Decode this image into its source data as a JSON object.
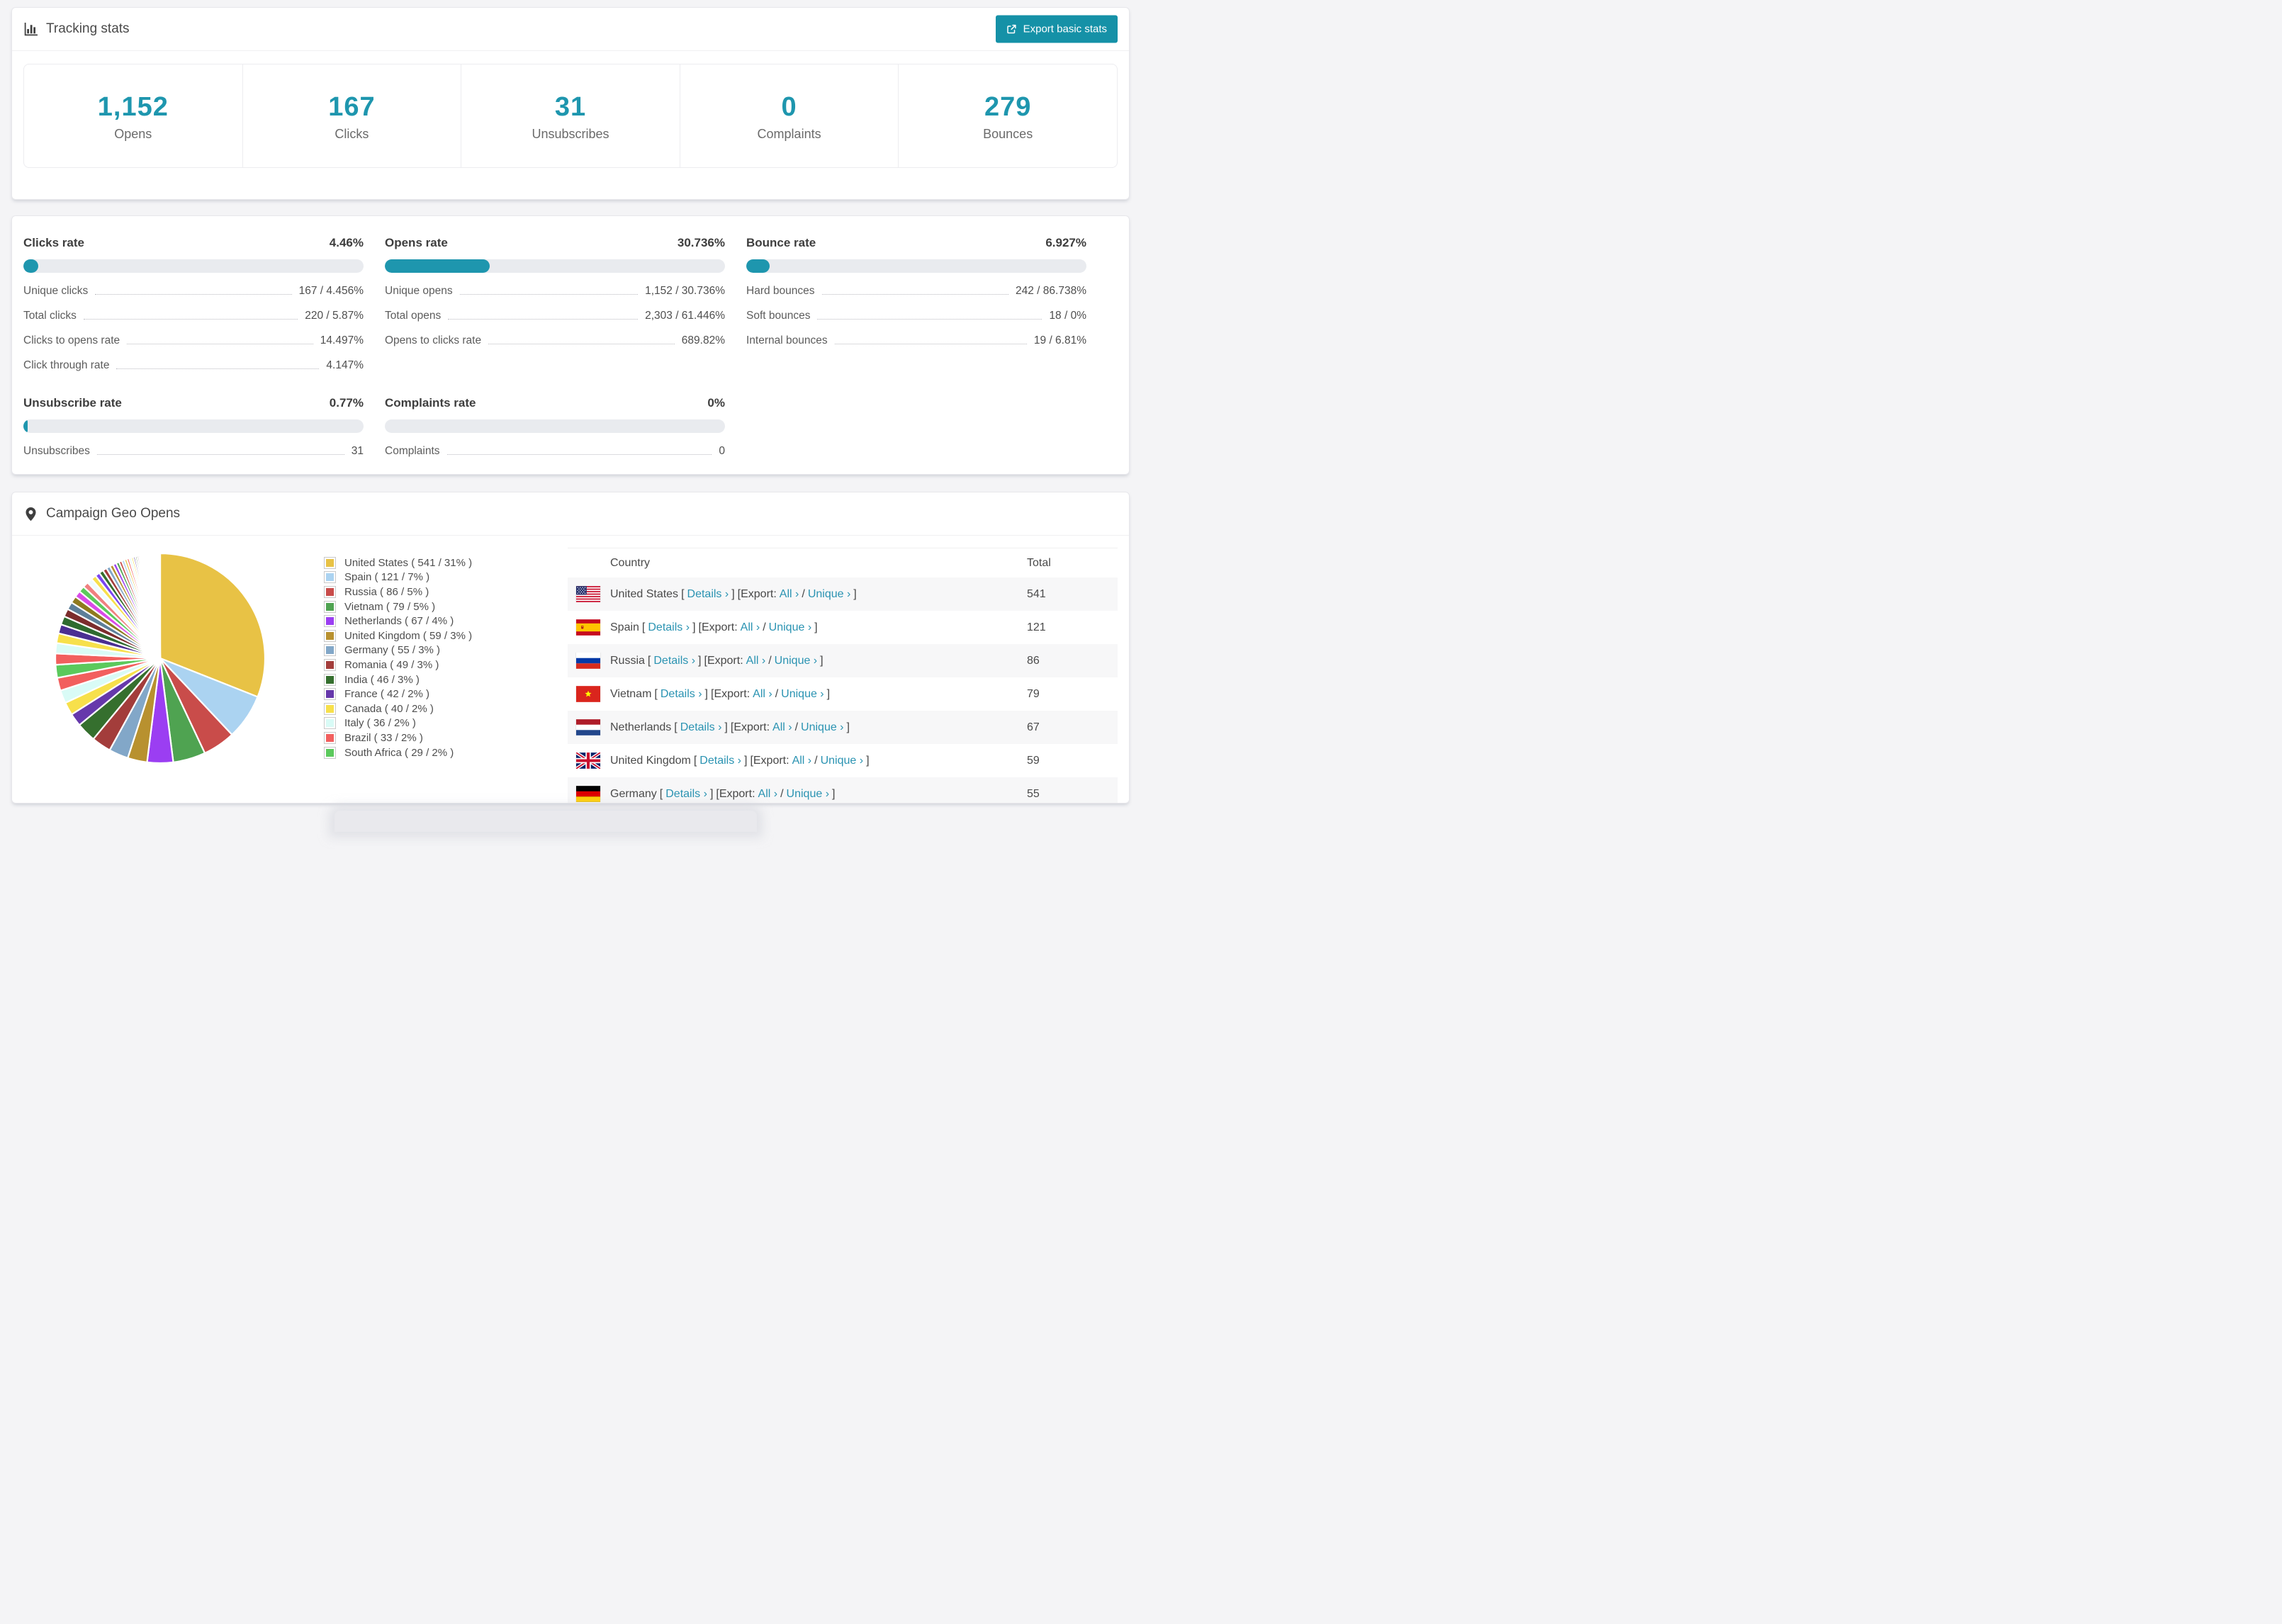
{
  "colors": {
    "accent_teal": "#1e96ae",
    "button_teal": "#1591a7",
    "link_teal": "#2a93b2",
    "bar_track": "#e9ebef",
    "page_background": "#f4f4f6"
  },
  "tracking": {
    "title": "Tracking stats",
    "icon": "bar-chart-icon",
    "export_label": "Export basic stats",
    "stats": [
      {
        "value": "1,152",
        "label": "Opens"
      },
      {
        "value": "167",
        "label": "Clicks"
      },
      {
        "value": "31",
        "label": "Unsubscribes"
      },
      {
        "value": "0",
        "label": "Complaints"
      },
      {
        "value": "279",
        "label": "Bounces"
      }
    ]
  },
  "rates": [
    {
      "title": "Clicks rate",
      "value": "4.46%",
      "percent": 4.46,
      "rows": [
        {
          "label": "Unique clicks",
          "value": "167 / 4.456%"
        },
        {
          "label": "Total clicks",
          "value": "220 / 5.87%"
        },
        {
          "label": "Clicks to opens rate",
          "value": "14.497%"
        },
        {
          "label": "Click through rate",
          "value": "4.147%"
        }
      ]
    },
    {
      "title": "Opens rate",
      "value": "30.736%",
      "percent": 30.736,
      "rows": [
        {
          "label": "Unique opens",
          "value": "1,152 / 30.736%"
        },
        {
          "label": "Total opens",
          "value": "2,303 / 61.446%"
        },
        {
          "label": "Opens to clicks rate",
          "value": "689.82%"
        }
      ]
    },
    {
      "title": "Bounce rate",
      "value": "6.927%",
      "percent": 6.927,
      "rows": [
        {
          "label": "Hard bounces",
          "value": "242 / 86.738%"
        },
        {
          "label": "Soft bounces",
          "value": "18 / 0%"
        },
        {
          "label": "Internal bounces",
          "value": "19 / 6.81%"
        }
      ]
    },
    {
      "title": "Unsubscribe rate",
      "value": "0.77%",
      "percent": 0.77,
      "rows": [
        {
          "label": "Unsubscribes",
          "value": "31"
        }
      ]
    },
    {
      "title": "Complaints rate",
      "value": "0%",
      "percent": 0,
      "rows": [
        {
          "label": "Complaints",
          "value": "0"
        }
      ]
    }
  ],
  "geo": {
    "title": "Campaign Geo Opens",
    "icon": "map-pin-icon",
    "table": {
      "columns": [
        "Country",
        "Total"
      ],
      "details_label": "Details",
      "export_label": "Export:",
      "all_label": "All",
      "unique_label": "Unique",
      "chevron": "›",
      "rows": [
        {
          "country": "United States",
          "total": "541",
          "flag": "us"
        },
        {
          "country": "Spain",
          "total": "121",
          "flag": "es"
        },
        {
          "country": "Russia",
          "total": "86",
          "flag": "ru"
        },
        {
          "country": "Vietnam",
          "total": "79",
          "flag": "vn"
        },
        {
          "country": "Netherlands",
          "total": "67",
          "flag": "nl"
        },
        {
          "country": "United Kingdom",
          "total": "59",
          "flag": "gb"
        },
        {
          "country": "Germany",
          "total": "55",
          "flag": "de"
        }
      ]
    }
  },
  "chart_data": {
    "type": "pie",
    "title": "Campaign Geo Opens",
    "unit": "opens",
    "legend_position": "right",
    "start_angle_deg": -90,
    "direction": "clockwise",
    "slices": [
      {
        "label": "United States",
        "count": 541,
        "percent": 31,
        "color": "#e8c245"
      },
      {
        "label": "Spain",
        "count": 121,
        "percent": 7,
        "color": "#abd3f1"
      },
      {
        "label": "Russia",
        "count": 86,
        "percent": 5,
        "color": "#c94c4a"
      },
      {
        "label": "Vietnam",
        "count": 79,
        "percent": 5,
        "color": "#4fa351"
      },
      {
        "label": "Netherlands",
        "count": 67,
        "percent": 4,
        "color": "#9b3ef2"
      },
      {
        "label": "United Kingdom",
        "count": 59,
        "percent": 3,
        "color": "#b8912f"
      },
      {
        "label": "Germany",
        "count": 55,
        "percent": 3,
        "color": "#82a7c8"
      },
      {
        "label": "Romania",
        "count": 49,
        "percent": 3,
        "color": "#a33d3b"
      },
      {
        "label": "India",
        "count": 46,
        "percent": 3,
        "color": "#356f2e"
      },
      {
        "label": "France",
        "count": 42,
        "percent": 2,
        "color": "#6638ab"
      },
      {
        "label": "Canada",
        "count": 40,
        "percent": 2,
        "color": "#f7e04b"
      },
      {
        "label": "Italy",
        "count": 36,
        "percent": 2,
        "color": "#d9fbf6"
      },
      {
        "label": "Brazil",
        "count": 33,
        "percent": 2,
        "color": "#f25f5e"
      },
      {
        "label": "South Africa",
        "count": 29,
        "percent": 2,
        "color": "#5bc95c"
      }
    ],
    "others_percent": 26,
    "others_slice_count": 60,
    "others_decay_ratio": 0.935,
    "others_palette": [
      "#f25f5e",
      "#d9fbf6",
      "#f7e04b",
      "#4b2f92",
      "#2f6b2f",
      "#7c2d2d",
      "#5d7f99",
      "#8f7a1e",
      "#d94ae8",
      "#5bc95c",
      "#f08080",
      "#eefcff",
      "#f7e04b",
      "#7a44f0",
      "#356f2e",
      "#a33d3b",
      "#82a7c8",
      "#b8912f",
      "#9b3ef2",
      "#4fa351",
      "#c94c4a",
      "#abd3f1",
      "#e8c245"
    ]
  }
}
